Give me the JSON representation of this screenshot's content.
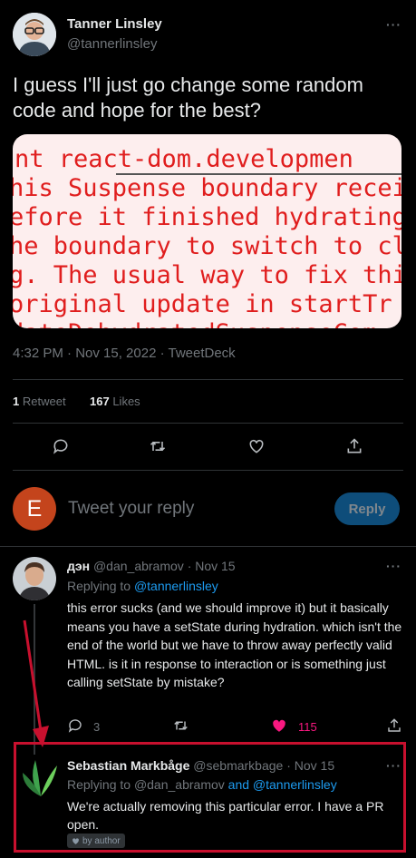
{
  "main_tweet": {
    "author_name": "Tanner Linsley",
    "author_handle": "@tannerlinsley",
    "more": "···",
    "text": "I guess I'll just go change some random code and hope for the best?",
    "media_lines": [
      "nt     react-dom.developmen",
      "his Suspense boundary recei",
      "efore it finished hydrating",
      "he boundary to switch to cl",
      "g. The usual way to fix thi",
      " original update in startTr",
      "dateDehydratedSuspenseCom"
    ],
    "timestamp": "4:32 PM · Nov 15, 2022 · TweetDeck",
    "retweets_count": "1",
    "retweets_label": "Retweet",
    "likes_count": "167",
    "likes_label": "Likes"
  },
  "reply_box": {
    "avatar_letter": "E",
    "placeholder": "Tweet your reply",
    "button_label": "Reply"
  },
  "replies": [
    {
      "author_name": "дэн",
      "author_handle": "@dan_abramov",
      "date": "· Nov 15",
      "replying_prefix": "Replying to ",
      "replying_to": "@tannerlinsley",
      "text": "this error sucks (and we should improve it) but it basically means you have a setState during hydration. which isn't the end of the world but we have to throw away perfectly valid HTML. is it in response to interaction or is something just calling setState by mistake?",
      "reply_count": "3",
      "like_count": "115"
    },
    {
      "author_name": "Sebastian Markbåge",
      "author_handle": "@sebmarkbage",
      "date": "· Nov 15",
      "replying_prefix": "Replying to ",
      "replying_to_1": "@dan_abramov",
      "replying_and": " and ",
      "replying_to_2": "@tannerlinsley",
      "text": "We're actually removing this particular error. I have a PR open.",
      "badge": "by author"
    }
  ],
  "colors": {
    "background": "#000000",
    "accent": "#1d9bf0",
    "like_active": "#f91880",
    "annotation": "#c8102e"
  }
}
